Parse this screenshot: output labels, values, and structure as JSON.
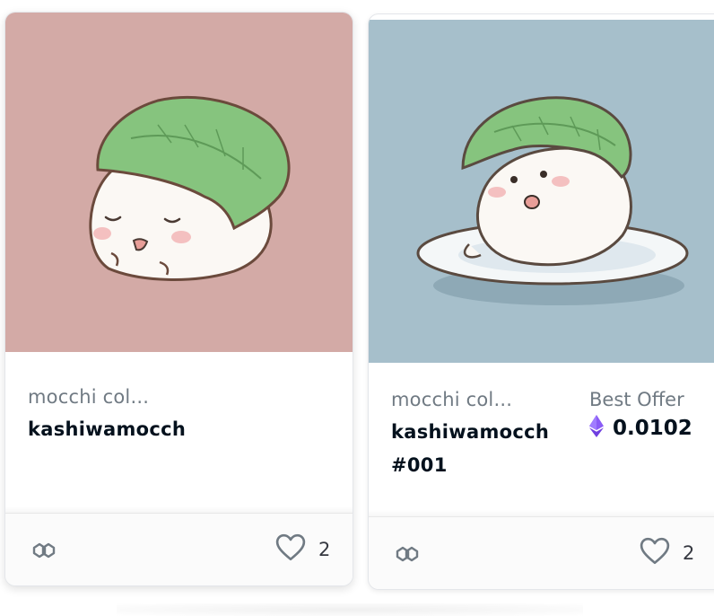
{
  "cards": [
    {
      "collection": "mocchi col...",
      "name": "kashiwamocch",
      "favorites": "2",
      "bg_color": "#d3aaa6",
      "chain_icon": "polygon-icon",
      "favorite_icon": "heart-outline-icon"
    },
    {
      "collection": "mocchi col...",
      "name_line1": "kashiwamocch",
      "name_line2": "#001",
      "best_offer_label": "Best Offer",
      "best_offer_price": "0.0102",
      "currency_icon": "ethereum-icon",
      "favorites": "2",
      "bg_color": "#a6bfcb",
      "chain_icon": "polygon-icon",
      "favorite_icon": "heart-outline-icon"
    }
  ]
}
